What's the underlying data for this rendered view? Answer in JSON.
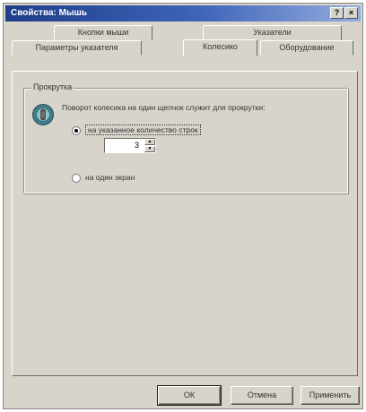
{
  "window": {
    "title": "Свойства: Мышь",
    "help_button": "?",
    "close_button": "×"
  },
  "tabs": {
    "row_back": [
      {
        "label": "Кнопки мыши"
      },
      {
        "label": "Указатели"
      }
    ],
    "row_front": [
      {
        "label": "Параметры указателя"
      },
      {
        "label": "Колесико"
      },
      {
        "label": "Оборудование"
      }
    ],
    "active": "Колесико"
  },
  "scroll_group": {
    "label": "Прокрутка",
    "icon": "mouse-wheel-icon",
    "description": "Поворот колесика на один щелчок служит для прокрутки:",
    "option_lines": {
      "label": "на указанное количество строк",
      "checked": true
    },
    "lines_value": "3",
    "option_page": {
      "label": "на один экран",
      "checked": false
    }
  },
  "buttons": {
    "ok": "ОК",
    "cancel": "Отмена",
    "apply": "Применить"
  }
}
